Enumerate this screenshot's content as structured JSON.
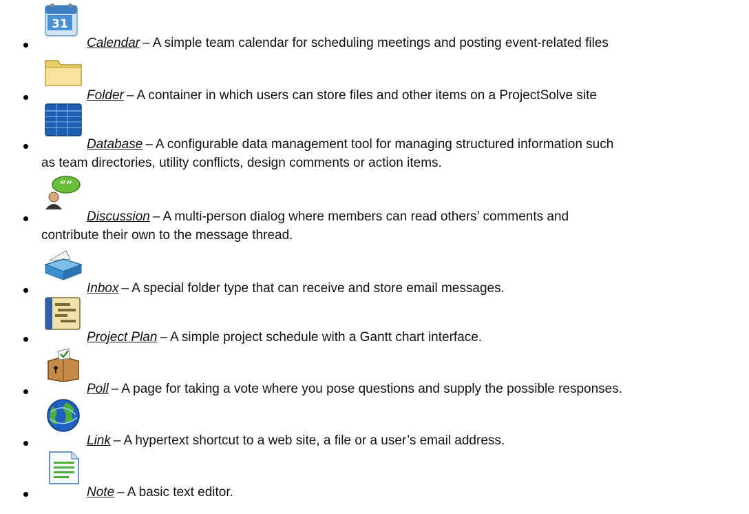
{
  "items": [
    {
      "icon": "calendar-icon",
      "link": "Calendar",
      "description": "A simple team calendar for scheduling meetings and posting event-related files",
      "description_cont": ""
    },
    {
      "icon": "folder-icon",
      "link": "Folder",
      "description": "A container in which users can store files and other items on a ProjectSolve site",
      "description_cont": ""
    },
    {
      "icon": "database-icon",
      "link": "Database",
      "description": "A configurable data management tool for managing structured information such",
      "description_cont": "as team directories, utility conflicts, design comments or action items."
    },
    {
      "icon": "discussion-icon",
      "link": "Discussion",
      "description": "A multi-person dialog where members can read others’ comments and",
      "description_cont": "contribute their own to the message thread."
    },
    {
      "icon": "inbox-icon",
      "link": "Inbox",
      "description": "A special folder type that can receive and store email messages.",
      "description_cont": ""
    },
    {
      "icon": "project-plan-icon",
      "link": "Project Plan",
      "description": "A simple project schedule with a Gantt chart interface.",
      "description_cont": ""
    },
    {
      "icon": "poll-icon",
      "link": "Poll",
      "description": "A page for taking a vote where you pose questions and supply the possible responses.",
      "description_cont": ""
    },
    {
      "icon": "link-globe-icon",
      "link": "Link",
      "description": "A hypertext shortcut to a web site, a file or a user’s email address.",
      "description_cont": ""
    },
    {
      "icon": "note-icon",
      "link": "Note",
      "description": "A basic text editor.",
      "description_cont": ""
    }
  ],
  "separator": "–"
}
